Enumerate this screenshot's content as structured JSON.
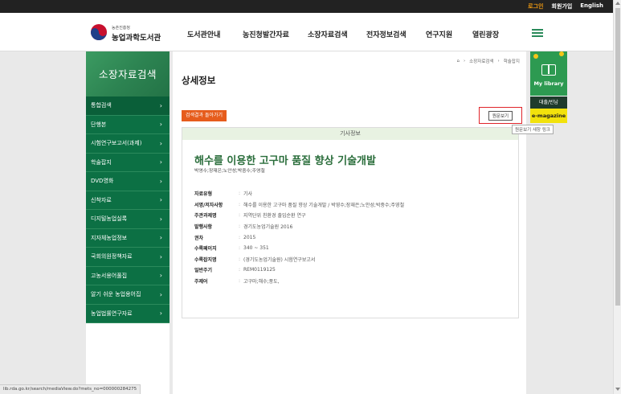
{
  "topbar": {
    "login": "로그인",
    "signup": "회원가입",
    "english": "English"
  },
  "header": {
    "logo_small": "농촌진흥청",
    "logo_big": "농업과학도서관",
    "nav": [
      "도서관안내",
      "농진청발간자료",
      "소장자료검색",
      "전자정보검색",
      "연구지원",
      "열린광장"
    ]
  },
  "sidebar": {
    "title": "소장자료검색",
    "items": [
      {
        "label": "통합검색"
      },
      {
        "label": "단행본"
      },
      {
        "label": "시험연구보고서(과제)"
      },
      {
        "label": "학술잡지"
      },
      {
        "label": "DVD영화"
      },
      {
        "label": "신착자료"
      },
      {
        "label": "디지털농업실록"
      },
      {
        "label": "지자체농업정보"
      },
      {
        "label": "국회의원정책자료"
      },
      {
        "label": "고농서용어풀집"
      },
      {
        "label": "알기 쉬운 농업용어집"
      },
      {
        "label": "농업법률연구자료"
      }
    ]
  },
  "breadcrumb": {
    "home": "⌂",
    "level1": "소장자료검색",
    "level2": "학술잡지"
  },
  "page_title": "상세정보",
  "buttons": {
    "back": "검색결과 돌아가기",
    "view_original": "원문보기",
    "tooltip": "원문보기 새창 링크"
  },
  "card": {
    "header": "기사정보",
    "title": "해수를 이용한 고구마 품질 향상 기술개발",
    "authors": "박영수;장재은;노안성;박중수;주영철",
    "meta": [
      {
        "key": "자료유형",
        "value": "기사"
      },
      {
        "key": "서명/저자사항",
        "value": "해수를 이용한 고구마 품질 향상 기술개발 / 박영수;장재은;노안성;박중수;주영철"
      },
      {
        "key": "주관과제명",
        "value": "지역단위 친환경 출입순환 연구"
      },
      {
        "key": "발행사항",
        "value": "경기도농업기술원 2016"
      },
      {
        "key": "권차",
        "value": "2015"
      },
      {
        "key": "수록페이지",
        "value": "340 ~ 351"
      },
      {
        "key": "수록잡지명",
        "value": "(경기도농업기술원) 시험연구보고서"
      },
      {
        "key": "일반주기",
        "value": "REM0119125"
      },
      {
        "key": "주제어",
        "value": "고구마;해수;풍도,"
      }
    ]
  },
  "quick": {
    "mylib": "My library",
    "loan": "대출/반납",
    "emag": "e-magazine"
  },
  "status_url": "lib.rda.go.kr/search/mediaView.do?mets_no=000000284275"
}
